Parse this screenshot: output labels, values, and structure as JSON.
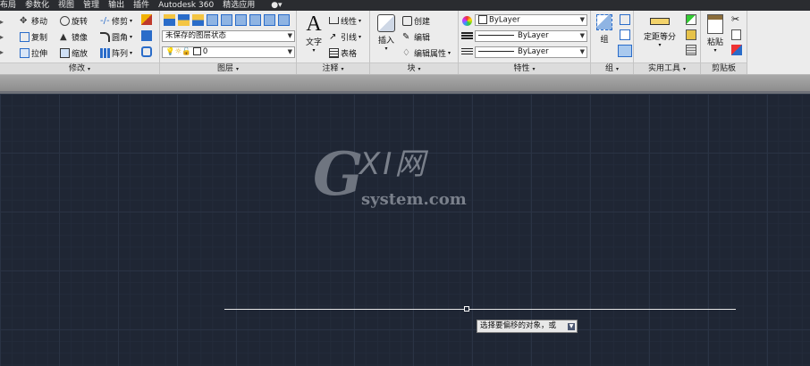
{
  "menu": [
    "布局",
    "参数化",
    "视图",
    "管理",
    "输出",
    "插件",
    "Autodesk 360",
    "精选应用"
  ],
  "modify": {
    "title": "修改",
    "r1": [
      "移动",
      "旋转",
      "修剪"
    ],
    "r2": [
      "复制",
      "镜像",
      "圆角"
    ],
    "r3": [
      "拉伸",
      "缩放",
      "阵列"
    ]
  },
  "layers": {
    "title": "图层",
    "state": "未保存的图层状态",
    "current": "0"
  },
  "annotation": {
    "title": "注释",
    "text_label": "文字",
    "items": [
      "线性",
      "引线",
      "表格"
    ]
  },
  "block": {
    "title": "块",
    "insert": "插入",
    "items": [
      "创建",
      "编辑",
      "编辑属性"
    ]
  },
  "properties": {
    "title": "特性",
    "color": "ByLayer",
    "linetype": "ByLayer",
    "lineweight": "ByLayer"
  },
  "group": {
    "title": "组",
    "label": "组"
  },
  "utilities": {
    "title": "实用工具",
    "measure": "定距等分"
  },
  "clipboard": {
    "title": "剪贴板",
    "paste": "粘贴"
  },
  "watermark": {
    "g": "G",
    "xi": "XI网",
    "sub": "system.com"
  },
  "tooltip": {
    "text": "选择要偏移的对象，或"
  }
}
